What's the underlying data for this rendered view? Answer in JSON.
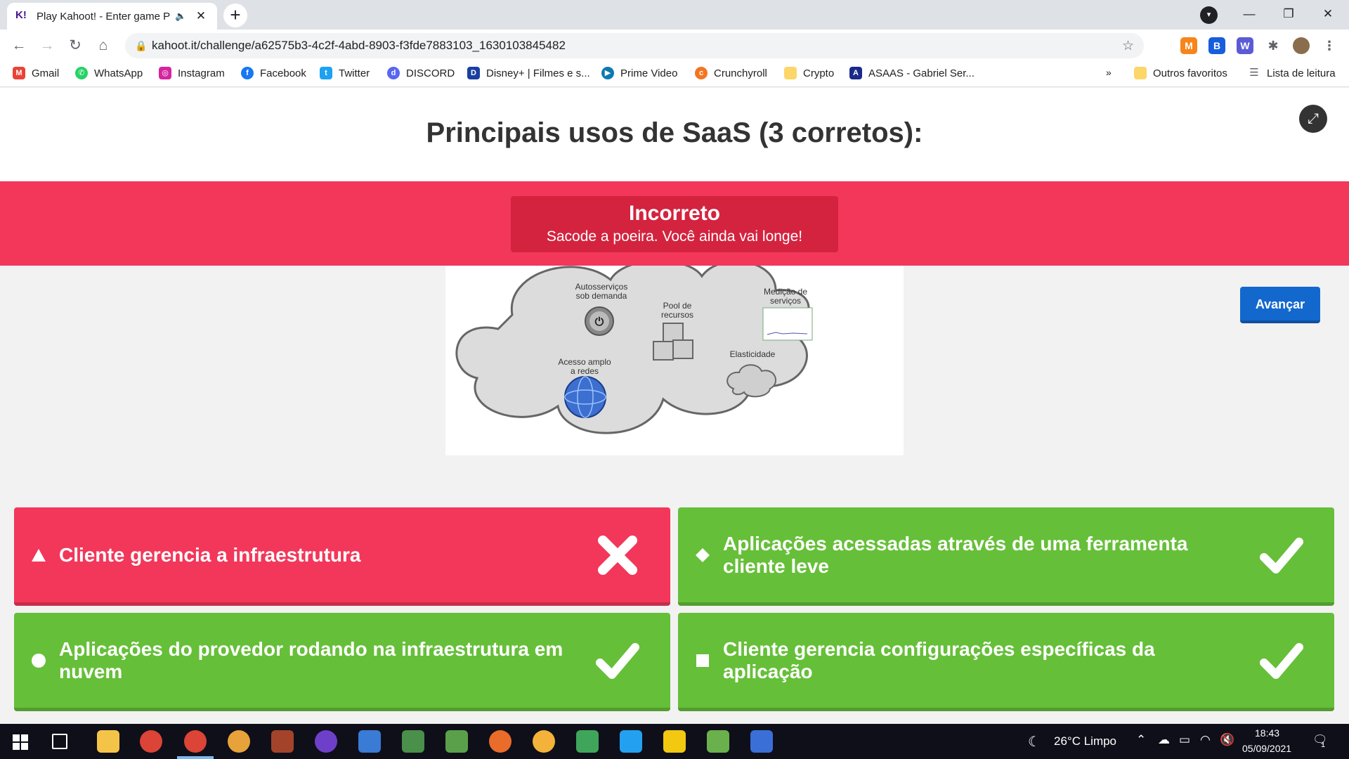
{
  "browser": {
    "tab_title": "Play Kahoot! - Enter game PI",
    "url": "kahoot.it/challenge/a62575b3-4c2f-4abd-8903-f3fde7883103_1630103845482"
  },
  "bookmarks": [
    {
      "label": "Gmail"
    },
    {
      "label": "WhatsApp"
    },
    {
      "label": "Instagram"
    },
    {
      "label": "Facebook"
    },
    {
      "label": "Twitter"
    },
    {
      "label": "DISCORD"
    },
    {
      "label": "Disney+ | Filmes e s..."
    },
    {
      "label": "Prime Video"
    },
    {
      "label": "Crunchyroll"
    },
    {
      "label": "Crypto"
    },
    {
      "label": "ASAAS - Gabriel Ser..."
    }
  ],
  "bookmarks_overflow": "»",
  "bookmarks_other": "Outros favoritos",
  "reading_list": "Lista de leitura",
  "question": {
    "title": "Principais usos de SaaS (3 corretos):"
  },
  "result": {
    "title": "Incorreto",
    "subtitle": "Sacode a poeira. Você ainda vai longe!"
  },
  "diagram_labels": {
    "self_service": [
      "Autosserviços",
      "sob demanda"
    ],
    "resource_pool": [
      "Pool de",
      "recursos"
    ],
    "measured": [
      "Medição de",
      "serviços"
    ],
    "network_access": [
      "Acesso amplo",
      "a redes"
    ],
    "elasticity": "Elasticidade"
  },
  "next_button": "Avançar",
  "answers": [
    {
      "text": "Cliente gerencia a infraestrutura",
      "shape": "triangle",
      "correct": false
    },
    {
      "text": "Aplicações acessadas através de uma ferramenta cliente leve",
      "shape": "diamond",
      "correct": true
    },
    {
      "text": "Aplicações do provedor rodando na infraestrutura em nuvem",
      "shape": "circle",
      "correct": true
    },
    {
      "text": "Cliente gerencia configurações específicas da aplicação",
      "shape": "square",
      "correct": true
    }
  ],
  "colors": {
    "wrong": "#f2375a",
    "right": "#66bf39",
    "button": "#1368ce"
  },
  "taskbar": {
    "weather": "26°C  Limpo",
    "time": "18:43",
    "date": "05/09/2021",
    "notifications": "1"
  }
}
